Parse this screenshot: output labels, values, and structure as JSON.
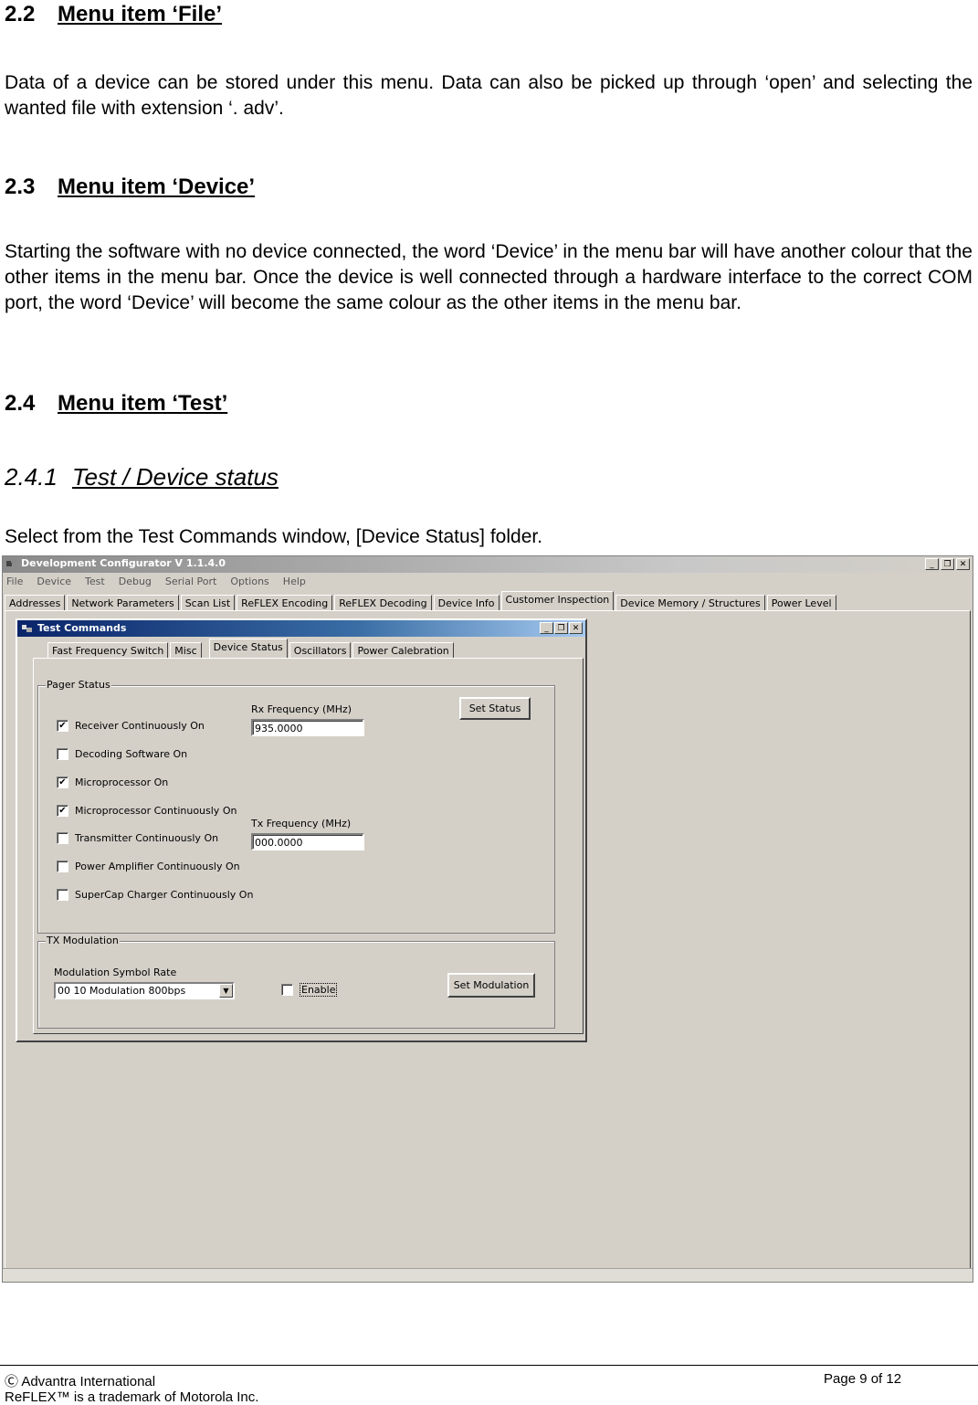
{
  "sections": {
    "s22": {
      "number": "2.2",
      "title": "Menu item ‘File’",
      "body": "Data of a device can be stored under this menu. Data can also be picked up through ‘open’ and selecting the wanted file with extension ‘. adv’."
    },
    "s23": {
      "number": "2.3",
      "title": "Menu item ‘Device’",
      "body": "Starting the software with no device connected, the word ‘Device’ in the menu bar will have another colour that the other items in the menu bar. Once the device is well connected through a hardware interface to the correct COM port, the word ‘Device’ will become the same colour as the other items in the menu bar."
    },
    "s24": {
      "number": "2.4",
      "title": "Menu item ‘Test’"
    },
    "s241": {
      "number": "2.4.1",
      "title": "Test / Device status",
      "body": "Select from the Test Commands window, [Device Status] folder."
    }
  },
  "app": {
    "title": "Development Configurator V 1.1.4.0",
    "menu": [
      "File",
      "Device",
      "Test",
      "Debug",
      "Serial Port",
      "Options",
      "Help"
    ],
    "tabs": [
      "Addresses",
      "Network Parameters",
      "Scan List",
      "ReFLEX Encoding",
      "ReFLEX Decoding",
      "Device Info",
      "Customer Inspection",
      "Device Memory / Structures",
      "Power Level"
    ],
    "active_tab": "Customer Inspection",
    "caption_buttons": [
      "_",
      "❐",
      "✕"
    ]
  },
  "test_commands": {
    "title": "Test Commands",
    "tabs": [
      "Fast Frequency Switch",
      "Misc",
      "Device Status",
      "Oscillators",
      "Power Calebration"
    ],
    "active_tab": "Device Status",
    "pager_status": {
      "label": "Pager Status",
      "checkboxes": [
        {
          "label": "Receiver Continuously On",
          "checked": true
        },
        {
          "label": "Decoding Software On",
          "checked": false
        },
        {
          "label": "Microprocessor On",
          "checked": true
        },
        {
          "label": "Microprocessor Continuously On",
          "checked": true
        },
        {
          "label": "Transmitter Continuously On",
          "checked": false
        },
        {
          "label": "Power Amplifier Continuously On",
          "checked": false
        },
        {
          "label": "SuperCap Charger Continuously On",
          "checked": false
        }
      ],
      "rx_label": "Rx Frequency (MHz)",
      "rx_value": "935.0000",
      "tx_label": "Tx Frequency (MHz)",
      "tx_value": "000.0000",
      "set_status": "Set Status"
    },
    "tx_modulation": {
      "label": "TX Modulation",
      "rate_label": "Modulation Symbol Rate",
      "rate_value": "00 10 Modulation 800bps",
      "enable_label": "Enable",
      "enable_checked": false,
      "set_modulation": "Set Modulation"
    }
  },
  "footer": {
    "copyright": "Ⓒ Advantra International",
    "page": "Page 9 of 12",
    "trademark": "ReFLEX™ is a trademark of Motorola Inc."
  }
}
